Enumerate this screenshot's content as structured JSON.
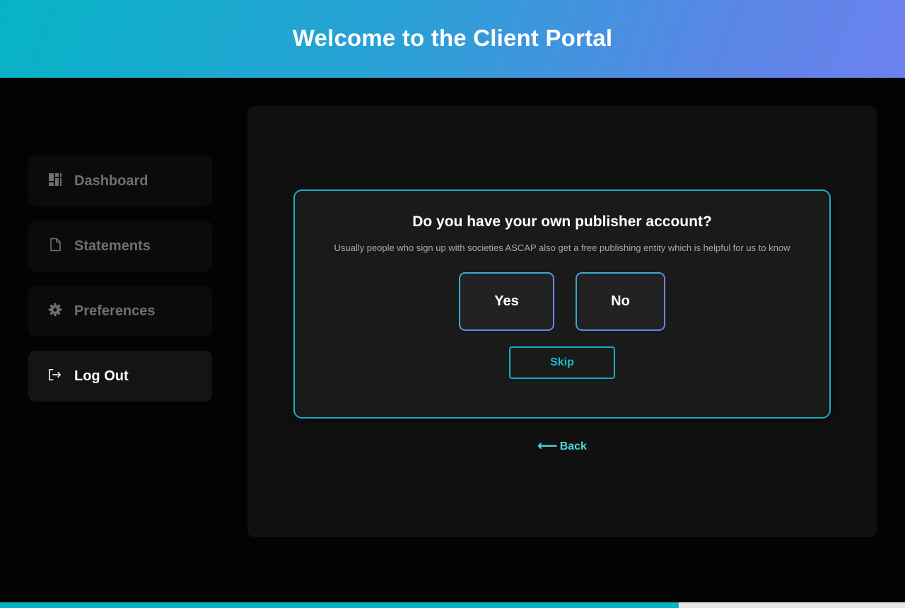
{
  "header": {
    "title": "Welcome to the Client Portal"
  },
  "sidebar": {
    "items": [
      {
        "label": "Dashboard",
        "icon": "dashboard-icon",
        "active": false
      },
      {
        "label": "Statements",
        "icon": "document-icon",
        "active": false
      },
      {
        "label": "Preferences",
        "icon": "gear-icon",
        "active": false
      },
      {
        "label": "Log Out",
        "icon": "logout-icon",
        "active": true
      }
    ]
  },
  "question": {
    "title": "Do you have your own publisher account?",
    "description": "Usually people who sign up with societies ASCAP also get a free publishing entity which is helpful for us to know",
    "yes_label": "Yes",
    "no_label": "No",
    "skip_label": "Skip"
  },
  "back": {
    "arrow": "⟵",
    "label": "Back"
  },
  "progress": {
    "fraction": 0.75
  },
  "colors": {
    "accent": "#14aec4",
    "header_gradient_start": "#06b3c6",
    "header_gradient_end": "#6d82ee",
    "back_link": "#4fd6d6"
  }
}
